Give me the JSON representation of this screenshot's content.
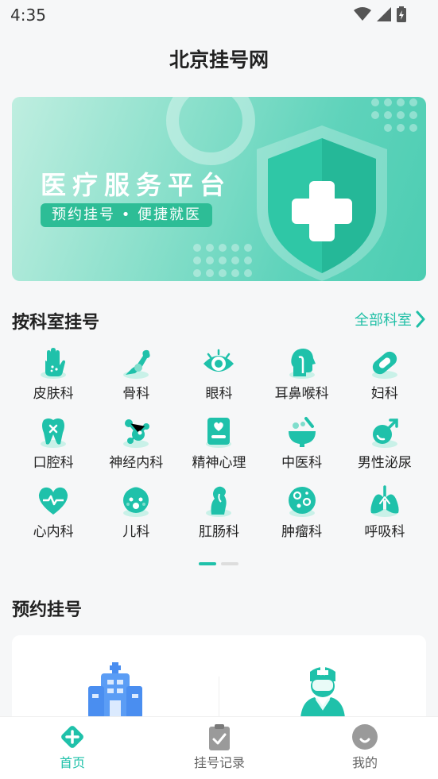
{
  "status_bar": {
    "time": "4:35"
  },
  "app_title": "北京挂号网",
  "banner": {
    "title": "医疗服务平台",
    "subtitle": "预约挂号 • 便捷就医"
  },
  "departments_section": {
    "title": "按科室挂号",
    "more_label": "全部科室",
    "items": [
      {
        "label": "皮肤科",
        "icon": "hand-icon"
      },
      {
        "label": "骨科",
        "icon": "bone-icon"
      },
      {
        "label": "眼科",
        "icon": "eye-icon"
      },
      {
        "label": "耳鼻喉科",
        "icon": "head-profile-icon"
      },
      {
        "label": "妇科",
        "icon": "pill-icon"
      },
      {
        "label": "口腔科",
        "icon": "tooth-icon"
      },
      {
        "label": "神经内科",
        "icon": "neuron-icon"
      },
      {
        "label": "精神心理",
        "icon": "mind-icon"
      },
      {
        "label": "中医科",
        "icon": "mortar-icon"
      },
      {
        "label": "男性泌尿",
        "icon": "male-icon"
      },
      {
        "label": "心内科",
        "icon": "heart-pulse-icon"
      },
      {
        "label": "儿科",
        "icon": "baby-icon"
      },
      {
        "label": "肛肠科",
        "icon": "intestine-icon"
      },
      {
        "label": "肿瘤科",
        "icon": "cell-icon"
      },
      {
        "label": "呼吸科",
        "icon": "lungs-icon"
      }
    ],
    "pager": {
      "pages": 2,
      "active": 0
    }
  },
  "appointment_section": {
    "title": "预约挂号",
    "options": [
      {
        "icon": "hospital-icon"
      },
      {
        "icon": "doctor-icon"
      }
    ]
  },
  "tabbar": {
    "tabs": [
      {
        "label": "首页",
        "icon": "home-icon",
        "active": true
      },
      {
        "label": "挂号记录",
        "icon": "clipboard-check-icon",
        "active": false
      },
      {
        "label": "我的",
        "icon": "user-icon",
        "active": false
      }
    ]
  },
  "colors": {
    "accent": "#1fc1aa",
    "text": "#222222",
    "inactive": "#666666"
  }
}
